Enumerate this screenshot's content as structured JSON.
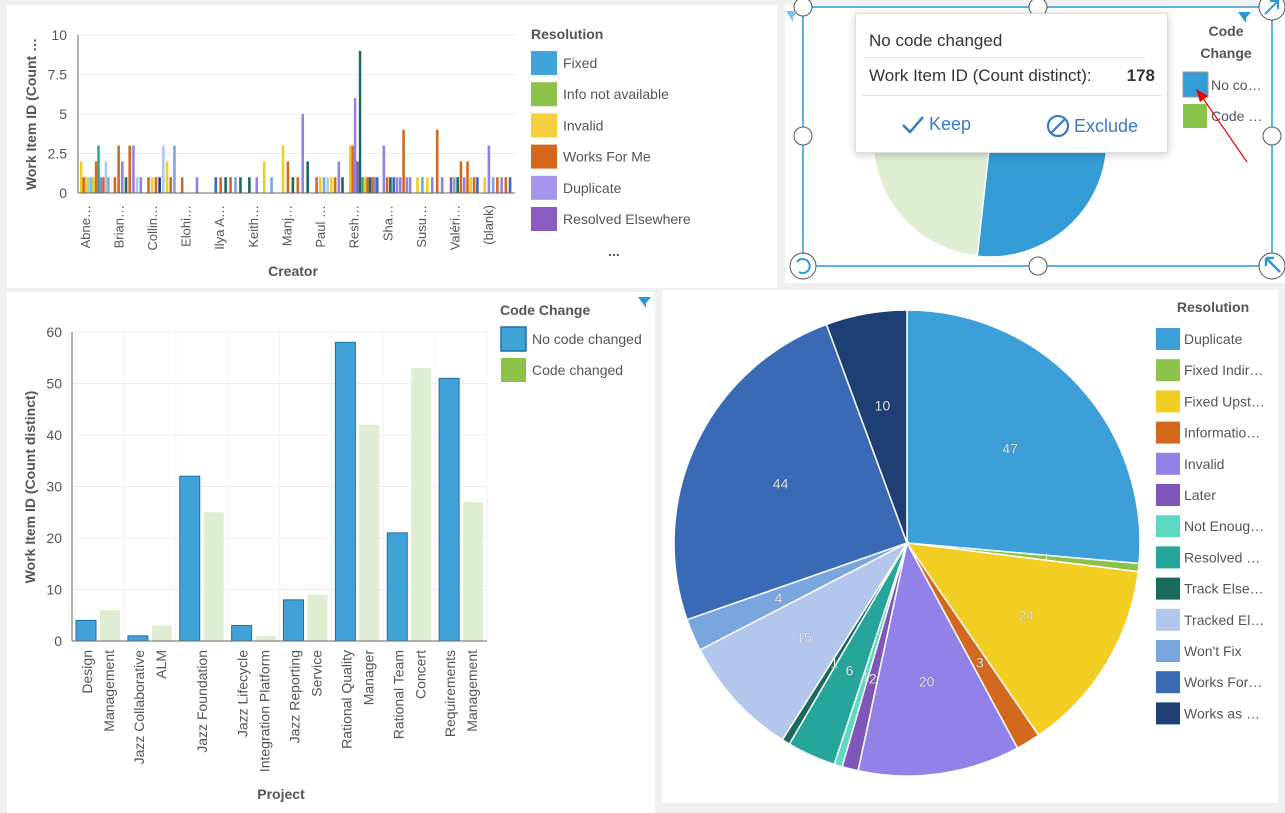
{
  "colors": {
    "selection": "#2a9ad6",
    "palette": [
      "#3d9fd8",
      "#8bc34a",
      "#f2cd22",
      "#d2691e",
      "#9282e8",
      "#7e57b8",
      "#5dd9c1",
      "#26a69a",
      "#1a6b5e",
      "#b3c7ec",
      "#7aa6e0",
      "#3a6ab5",
      "#1e3f73"
    ],
    "no_code": "#41a2d8",
    "code": "#8bc34a",
    "code_faded": "#dfeed2"
  },
  "chart_data": [
    {
      "type": "bar",
      "ylabel": "Work Item ID (Count …",
      "xlabel": "Creator",
      "ylim": [
        0,
        10
      ],
      "yticks": [
        "0",
        "2.5",
        "5",
        "7.5",
        "10"
      ],
      "grid": true,
      "legend_placement": "right",
      "legend_title": "Resolution",
      "legend": [
        {
          "name": "Fixed",
          "color": "#42a5d8"
        },
        {
          "name": "Info not available",
          "color": "#8bc34a"
        },
        {
          "name": "Invalid",
          "color": "#f4d03f"
        },
        {
          "name": "Works For Me",
          "color": "#d4691e"
        },
        {
          "name": "Duplicate",
          "color": "#a593ec"
        },
        {
          "name": "Resolved Elsewhere",
          "color": "#8a5cc0"
        }
      ],
      "legend_more": "...",
      "categories": [
        "Abne…",
        "Brian…",
        "Collin…",
        "Elohi…",
        "Ilya A…",
        "Keith…",
        "Manj…",
        "Paul …",
        "Resh…",
        "Sha…",
        "Susu…",
        "Valéri…",
        "(blank)"
      ],
      "bars": [
        [
          [
            2,
            2
          ],
          [
            3,
            1
          ],
          [
            2,
            1
          ],
          [
            9,
            1
          ],
          [
            6,
            1
          ],
          [
            2,
            1
          ],
          [
            3,
            2
          ],
          [
            7,
            3
          ],
          [
            4,
            1
          ],
          [
            3,
            1
          ],
          [
            9,
            2
          ],
          [
            10,
            1
          ]
        ],
        [
          [
            3,
            1
          ],
          [
            3,
            3
          ],
          [
            4,
            2
          ],
          [
            8,
            1
          ],
          [
            3,
            3
          ],
          [
            4,
            3
          ],
          [
            9,
            1
          ],
          [
            4,
            1
          ]
        ],
        [
          [
            3,
            1
          ],
          [
            2,
            1
          ],
          [
            3,
            1
          ],
          [
            12,
            1
          ],
          [
            9,
            3
          ],
          [
            2,
            2
          ],
          [
            3,
            1
          ],
          [
            10,
            3
          ]
        ],
        [
          [
            3,
            1
          ],
          [
            4,
            1
          ]
        ],
        [
          [
            11,
            1
          ],
          [
            3,
            1
          ],
          [
            8,
            1
          ],
          [
            3,
            1
          ],
          [
            10,
            1
          ],
          [
            8,
            1
          ]
        ],
        [
          [
            8,
            1
          ],
          [
            4,
            1
          ],
          [
            2,
            2
          ],
          [
            10,
            1
          ]
        ],
        [
          [
            2,
            3
          ],
          [
            3,
            2
          ],
          [
            8,
            1
          ],
          [
            3,
            1
          ],
          [
            4,
            5
          ],
          [
            8,
            2
          ]
        ],
        [
          [
            3,
            1
          ],
          [
            2,
            1
          ],
          [
            10,
            1
          ],
          [
            9,
            1
          ],
          [
            2,
            1
          ],
          [
            3,
            1
          ],
          [
            4,
            2
          ],
          [
            8,
            1
          ]
        ],
        [
          [
            2,
            3
          ],
          [
            3,
            3
          ],
          [
            4,
            6
          ],
          [
            5,
            2
          ],
          [
            8,
            9
          ],
          [
            7,
            1
          ],
          [
            2,
            1
          ],
          [
            3,
            1
          ],
          [
            8,
            1
          ],
          [
            3,
            1
          ],
          [
            4,
            1
          ],
          [
            11,
            1
          ]
        ],
        [
          [
            4,
            3
          ],
          [
            3,
            1
          ],
          [
            8,
            1
          ],
          [
            11,
            1
          ],
          [
            4,
            1
          ],
          [
            4,
            1
          ],
          [
            3,
            4
          ],
          [
            4,
            1
          ],
          [
            4,
            1
          ]
        ],
        [
          [
            2,
            1
          ],
          [
            10,
            1
          ],
          [
            2,
            1
          ],
          [
            4,
            1
          ],
          [
            3,
            4
          ],
          [
            4,
            1
          ]
        ],
        [
          [
            5,
            1
          ],
          [
            10,
            1
          ],
          [
            8,
            1
          ],
          [
            3,
            2
          ],
          [
            4,
            1
          ],
          [
            3,
            2
          ],
          [
            2,
            1
          ],
          [
            3,
            1
          ],
          [
            11,
            1
          ]
        ],
        [
          [
            2,
            1
          ],
          [
            4,
            3
          ],
          [
            10,
            1
          ],
          [
            3,
            1
          ],
          [
            4,
            1
          ],
          [
            3,
            1
          ],
          [
            11,
            1
          ]
        ]
      ]
    },
    {
      "type": "pie",
      "legend_title": "Code Change",
      "legend": [
        "No co…",
        "Code …"
      ],
      "values": [
        178,
        166
      ],
      "series": [
        "No code changed",
        "Code changed"
      ]
    },
    {
      "type": "bar",
      "ylabel": "Work Item ID (Count distinct)",
      "xlabel": "Project",
      "ylim": [
        0,
        60
      ],
      "yticks": [
        "0",
        "10",
        "20",
        "30",
        "40",
        "50",
        "60"
      ],
      "grid": true,
      "legend_placement": "right",
      "legend_title": "Code Change",
      "categories": [
        [
          "Design",
          "Management"
        ],
        [
          "Jazz Collaborative",
          "ALM"
        ],
        [
          "Jazz Foundation"
        ],
        [
          "Jazz Lifecycle",
          "Integration Platform"
        ],
        [
          "Jazz Reporting",
          "Service"
        ],
        [
          "Rational Quality",
          "Manager"
        ],
        [
          "Rational Team",
          "Concert"
        ],
        [
          "Requirements",
          "Management"
        ]
      ],
      "series": [
        {
          "name": "No code changed",
          "values": [
            4,
            1,
            32,
            3,
            8,
            58,
            21,
            51
          ]
        },
        {
          "name": "Code changed",
          "values": [
            6,
            3,
            25,
            1,
            9,
            42,
            53,
            27
          ]
        }
      ]
    },
    {
      "type": "pie",
      "legend_title": "Resolution",
      "categories": [
        "Duplicate",
        "Fixed Indir…",
        "Fixed Upst…",
        "Informatio…",
        "Invalid",
        "Later",
        "Not Enoug…",
        "Resolved …",
        "Track Else…",
        "Tracked El…",
        "Won't Fix",
        "Works For…",
        "Works as …"
      ],
      "values": [
        47,
        1,
        24,
        3,
        20,
        2,
        1,
        6,
        1,
        15,
        4,
        44,
        10
      ]
    }
  ],
  "tooltip": {
    "title": "No code changed",
    "metric_label": "Work Item ID (Count distinct):",
    "metric_value": "178",
    "keep_label": "Keep",
    "exclude_label": "Exclude"
  }
}
